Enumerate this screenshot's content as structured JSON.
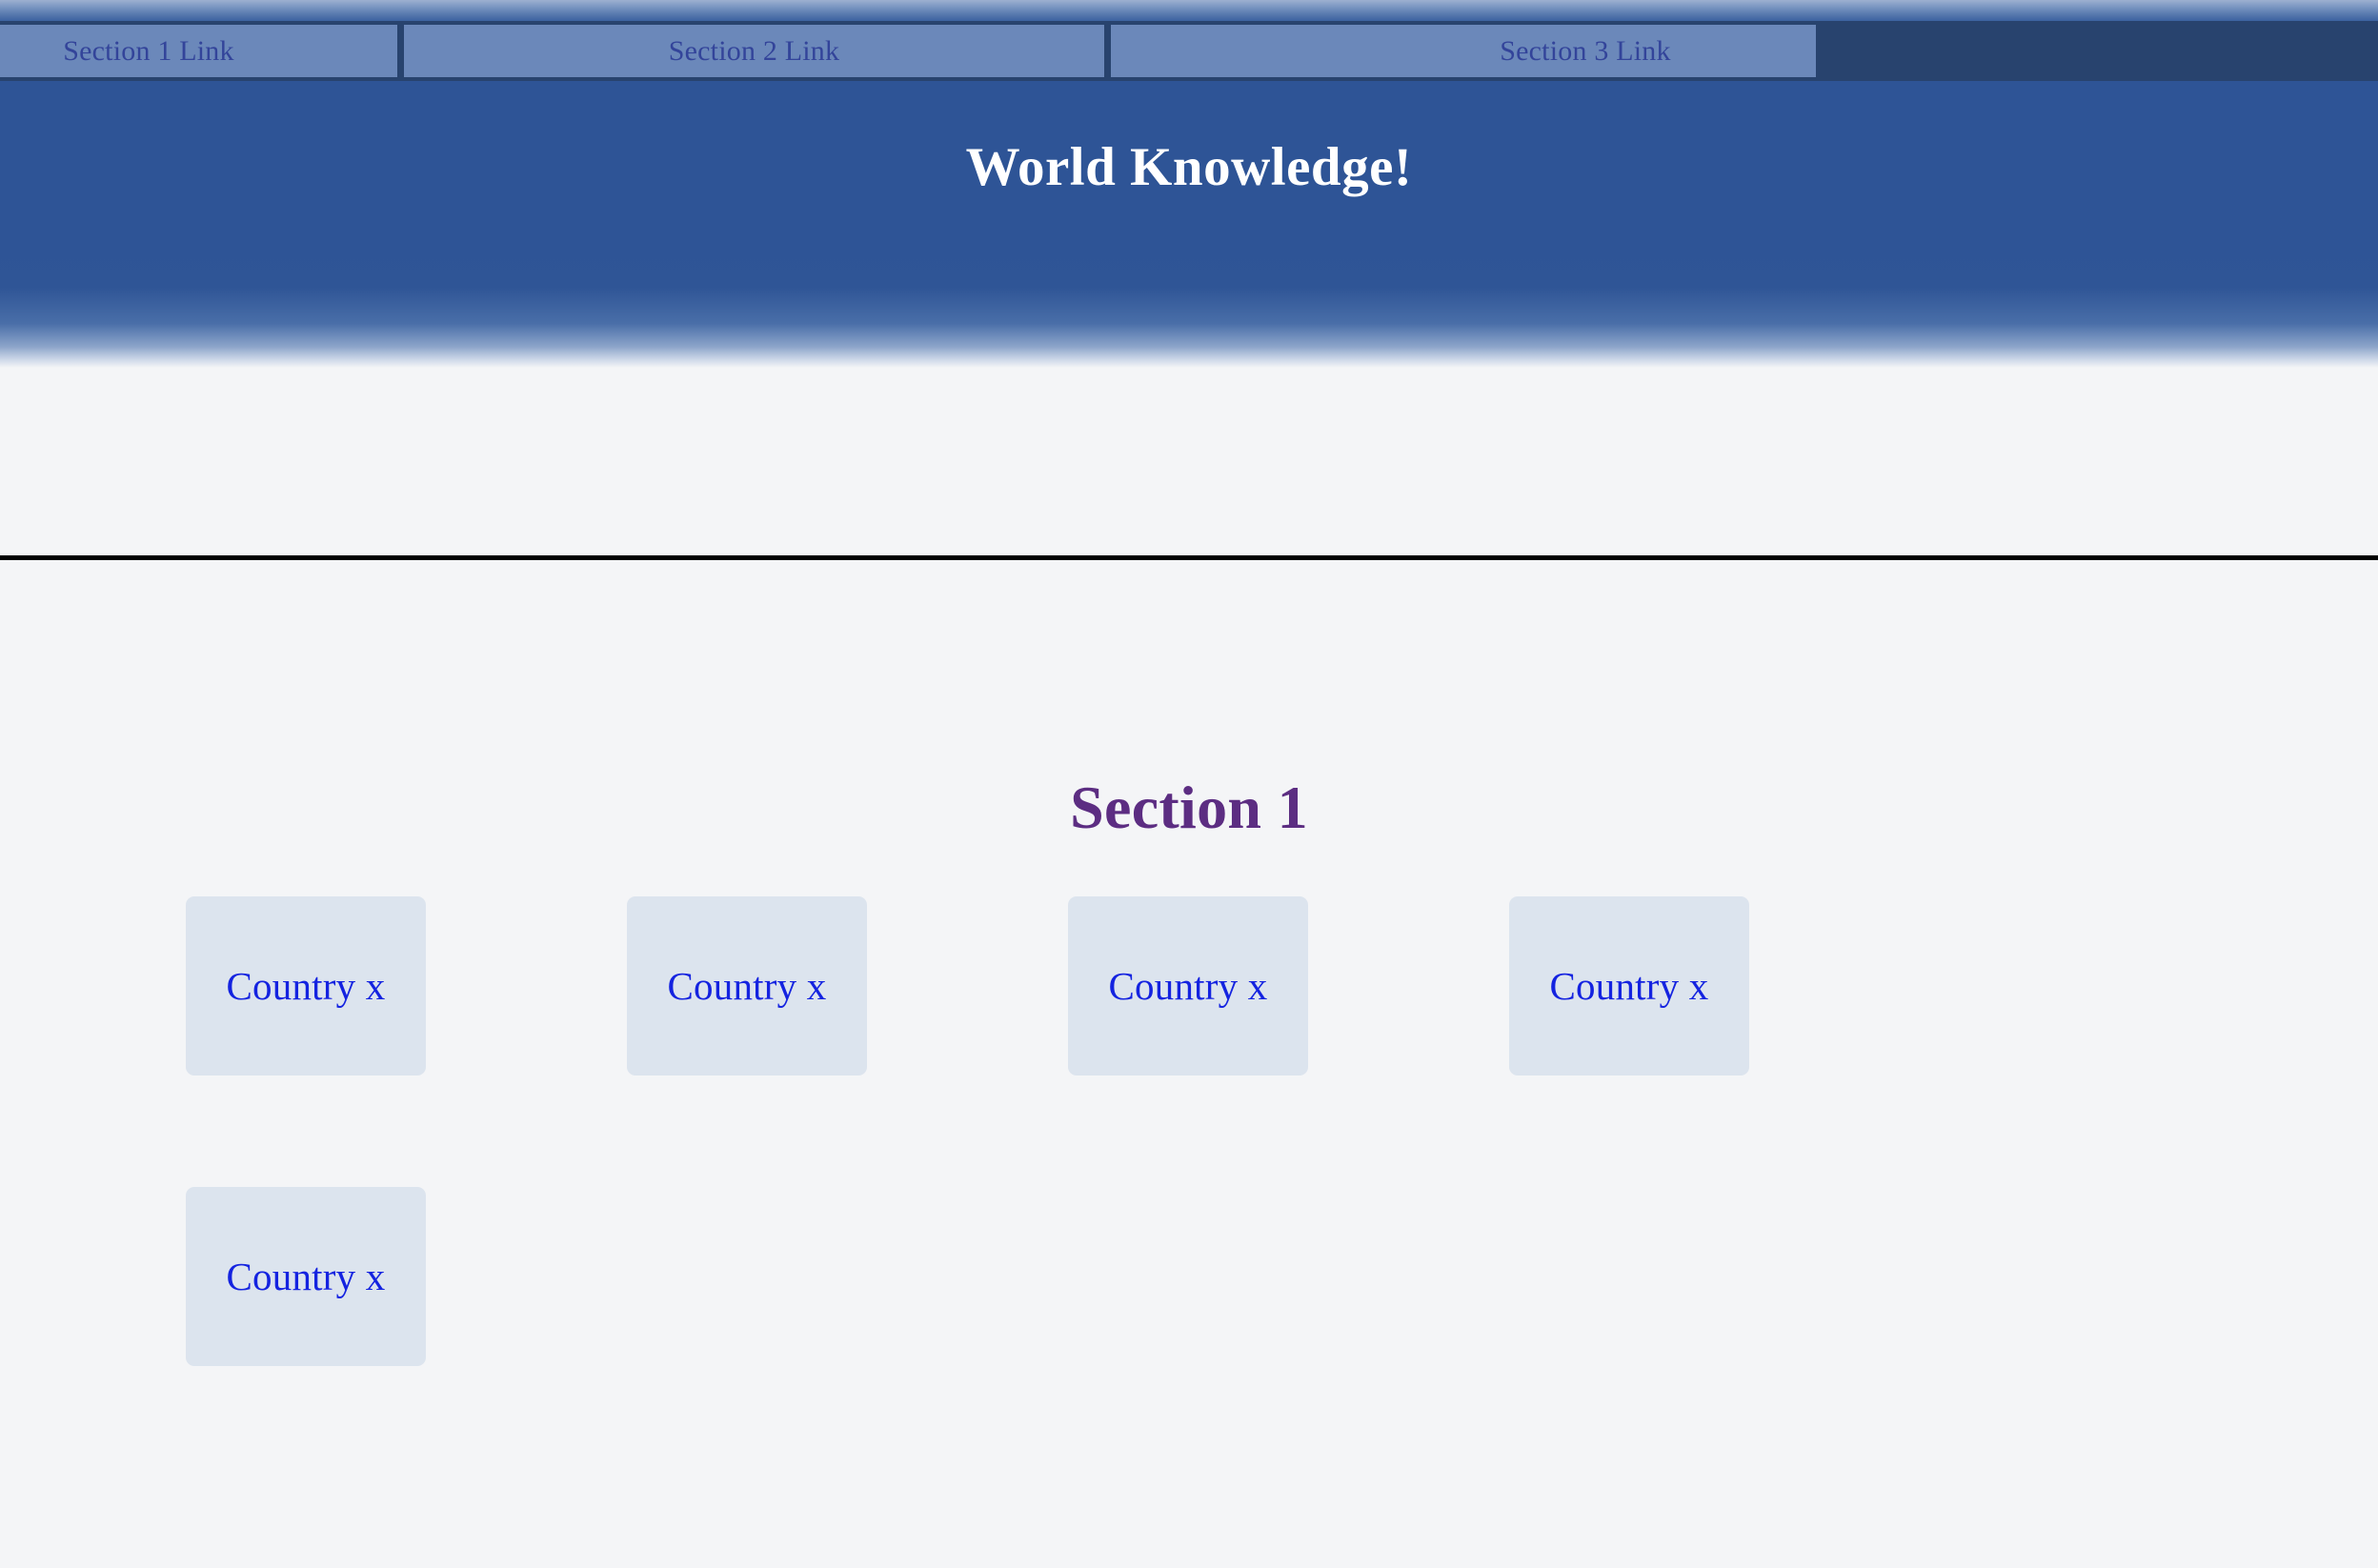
{
  "colors": {
    "nav_bar_bg": "#28436e",
    "nav_item_bg": "#6b88ba",
    "nav_link_text": "#33449a",
    "banner_bg": "#2e5496",
    "banner_text": "#ffffff",
    "page_bg": "#f4f5f7",
    "section_title": "#5c2d82",
    "card_bg": "#dce4ee",
    "card_text": "#1423e0",
    "rule": "#000000"
  },
  "nav": {
    "items": [
      {
        "label": "Section 1 Link",
        "clipped": "left"
      },
      {
        "label": "Section 2 Link",
        "clipped": "none"
      },
      {
        "label": "Section 3 Link",
        "clipped": "right"
      }
    ]
  },
  "banner": {
    "title": "World Knowledge!"
  },
  "main": {
    "section_title": "Section 1",
    "cards": [
      {
        "label": "Country x"
      },
      {
        "label": "Country x"
      },
      {
        "label": "Country x"
      },
      {
        "label": "Country x"
      },
      {
        "label": "Country x"
      }
    ]
  }
}
